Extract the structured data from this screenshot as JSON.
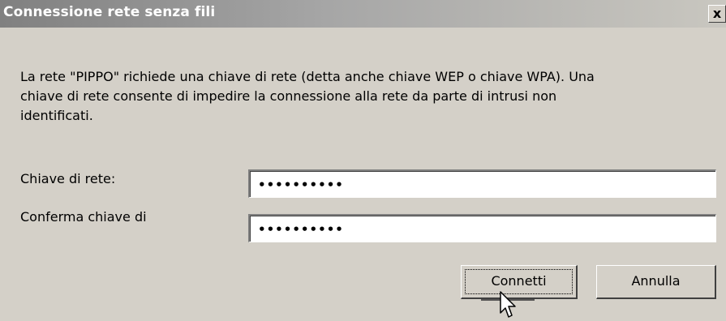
{
  "window": {
    "title": "Connessione rete senza fili",
    "close_glyph": "x"
  },
  "message": "La rete \"PIPPO\" richiede una chiave di rete (detta anche chiave WEP o chiave WPA). Una\nchiave di rete consente di impedire la connessione alla rete da parte di intrusi non\nidentificati.",
  "form": {
    "key_label": "Chiave di rete:",
    "key_value": "••••••••••",
    "confirm_label": "Conferma chiave di",
    "confirm_value": "••••••••••"
  },
  "buttons": {
    "connect": "Connetti",
    "cancel": "Annulla"
  },
  "cursor_icon": "arrow-pointer-icon"
}
